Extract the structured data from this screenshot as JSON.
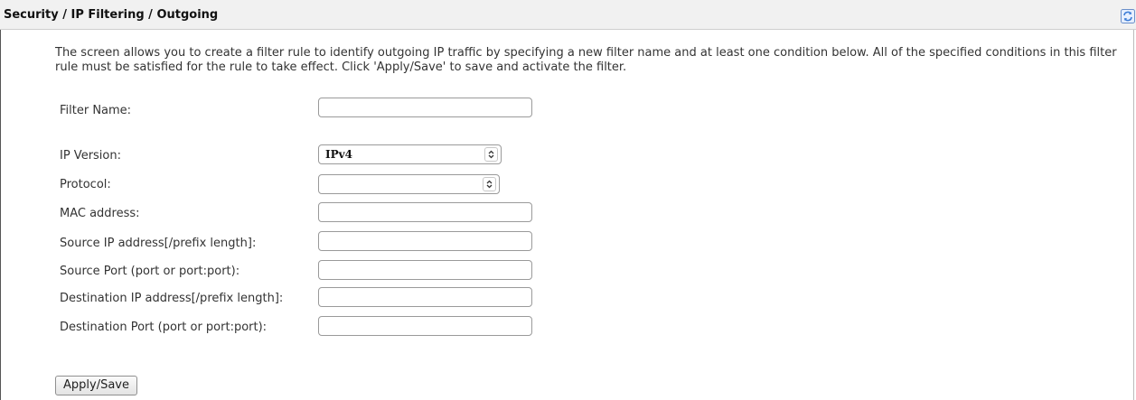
{
  "header": {
    "title": "Security / IP Filtering / Outgoing",
    "refresh_icon": "refresh-icon"
  },
  "intro": {
    "text": "The screen allows you to create a filter rule to identify outgoing IP traffic by specifying a new filter name and at least one condition below. All of the specified conditions in this filter rule must be satisfied for the rule to take effect. Click 'Apply/Save' to save and activate the filter."
  },
  "form": {
    "filter_name": {
      "label": "Filter Name:",
      "value": ""
    },
    "ip_version": {
      "label": "IP Version:",
      "value": "IPv4"
    },
    "protocol": {
      "label": "Protocol:",
      "value": ""
    },
    "mac_address": {
      "label": "MAC address:",
      "value": ""
    },
    "source_ip": {
      "label": "Source IP address[/prefix length]:",
      "value": ""
    },
    "source_port": {
      "label": "Source Port (port or port:port):",
      "value": ""
    },
    "dest_ip": {
      "label": "Destination IP address[/prefix length]:",
      "value": ""
    },
    "dest_port": {
      "label": "Destination Port (port or port:port):",
      "value": ""
    }
  },
  "actions": {
    "apply_save_label": "Apply/Save"
  },
  "colors": {
    "header_bg": "#f1f1f1",
    "refresh_icon": "#3a7bd5"
  }
}
